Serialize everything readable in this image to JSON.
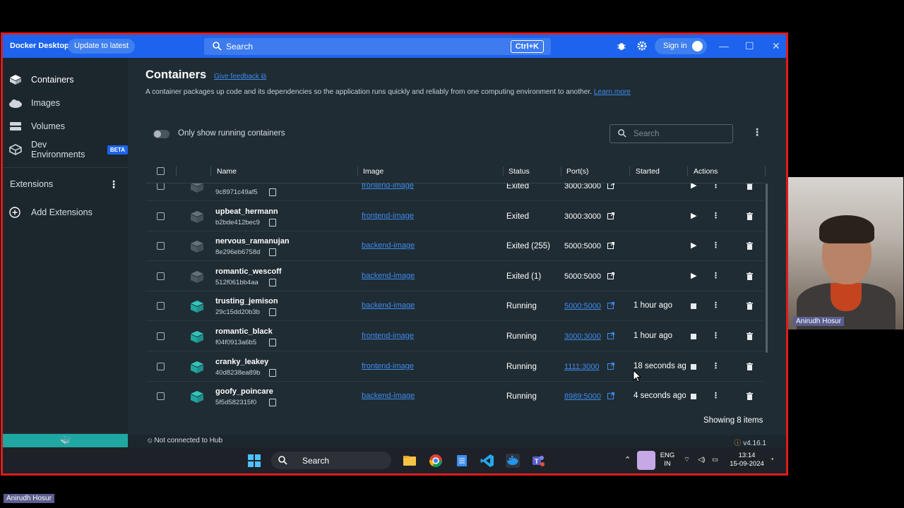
{
  "app": {
    "title": "Docker Desktop",
    "update_label": "Update to latest",
    "search_placeholder": "Search",
    "search_shortcut": "Ctrl+K",
    "signin_label": "Sign in"
  },
  "sidebar": {
    "items": [
      {
        "label": "Containers",
        "icon": "containers-icon"
      },
      {
        "label": "Images",
        "icon": "cloud-icon"
      },
      {
        "label": "Volumes",
        "icon": "volume-icon"
      },
      {
        "label": "Dev Environments",
        "icon": "dev-env-icon",
        "badge": "BETA"
      }
    ],
    "extensions_label": "Extensions",
    "add_extensions_label": "Add Extensions"
  },
  "page": {
    "title": "Containers",
    "feedback_label": "Give feedback",
    "description": "A container packages up code and its dependencies so the application runs quickly and reliably from one computing environment to another.",
    "learn_more": "Learn more",
    "toggle_label": "Only show running containers",
    "search_placeholder": "Search",
    "showing": "Showing 8 items"
  },
  "table": {
    "headers": {
      "name": "Name",
      "image": "Image",
      "status": "Status",
      "ports": "Port(s)",
      "started": "Started",
      "actions": "Actions"
    },
    "rows": [
      {
        "name": "",
        "id": "9c8971c49af5",
        "image": "frontend-image",
        "status": "Exited",
        "ports": "3000:3000",
        "started": "",
        "running": false
      },
      {
        "name": "upbeat_hermann",
        "id": "b2bde412bec9",
        "image": "frontend-image",
        "status": "Exited",
        "ports": "3000:3000",
        "started": "",
        "running": false
      },
      {
        "name": "nervous_ramanujan",
        "id": "8e296eb6758d",
        "image": "backend-image",
        "status": "Exited (255)",
        "ports": "5000:5000",
        "started": "",
        "running": false
      },
      {
        "name": "romantic_wescoff",
        "id": "512f061bb4aa",
        "image": "backend-image",
        "status": "Exited (1)",
        "ports": "5000:5000",
        "started": "",
        "running": false
      },
      {
        "name": "trusting_jemison",
        "id": "29c15dd20b3b",
        "image": "backend-image",
        "status": "Running",
        "ports": "5000:5000",
        "started": "1 hour ago",
        "running": true
      },
      {
        "name": "romantic_black",
        "id": "f04f0913a6b5",
        "image": "frontend-image",
        "status": "Running",
        "ports": "3000:3000",
        "started": "1 hour ago",
        "running": true
      },
      {
        "name": "cranky_leakey",
        "id": "40d8238ea89b",
        "image": "frontend-image",
        "status": "Running",
        "ports": "1111:3000",
        "started": "18 seconds ago",
        "running": true
      },
      {
        "name": "goofy_poincare",
        "id": "5f5d582315f0",
        "image": "backend-image",
        "status": "Running",
        "ports": "8989:5000",
        "started": "4 seconds ago",
        "running": true
      }
    ]
  },
  "statusbar": {
    "hub": "Not connected to Hub",
    "version": "v4.16.1"
  },
  "taskbar": {
    "search": "Search",
    "lang_top": "ENG",
    "lang_bottom": "IN",
    "time": "13:14",
    "date": "15-09-2024"
  },
  "webcam": {
    "label": "Anirudh Hosur"
  },
  "presenter_label": "Anirudh Hosur",
  "colors": {
    "accent": "#1d63ed",
    "running": "#20a7a1",
    "border": "#e01b1b"
  }
}
